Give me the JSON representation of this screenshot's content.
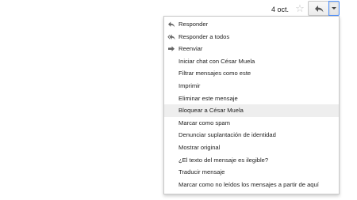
{
  "header": {
    "date": "4 oct.",
    "star_glyph": "☆",
    "star_icon": "star-outline-icon",
    "reply_icon": "reply-arrow-icon",
    "more_icon": "chevron-down-icon"
  },
  "menu": {
    "items": [
      {
        "label": "Responder",
        "icon": "reply-icon"
      },
      {
        "label": "Responder a todos",
        "icon": "reply-all-icon"
      },
      {
        "label": "Reenviar",
        "icon": "forward-icon"
      },
      {
        "label": "Iniciar chat con César Muela"
      },
      {
        "label": "Filtrar mensajes como este"
      },
      {
        "label": "Imprimir"
      },
      {
        "label": "Eliminar este mensaje"
      },
      {
        "label": "Bloquear a César Muela",
        "highlighted": true
      },
      {
        "label": "Marcar como spam"
      },
      {
        "label": "Denunciar suplantación de identidad"
      },
      {
        "label": "Mostrar original"
      },
      {
        "label": "¿El texto del mensaje es ilegible?"
      },
      {
        "label": "Traducir mensaje"
      },
      {
        "label": "Marcar como no leídos los mensajes a partir de aquí"
      }
    ]
  }
}
